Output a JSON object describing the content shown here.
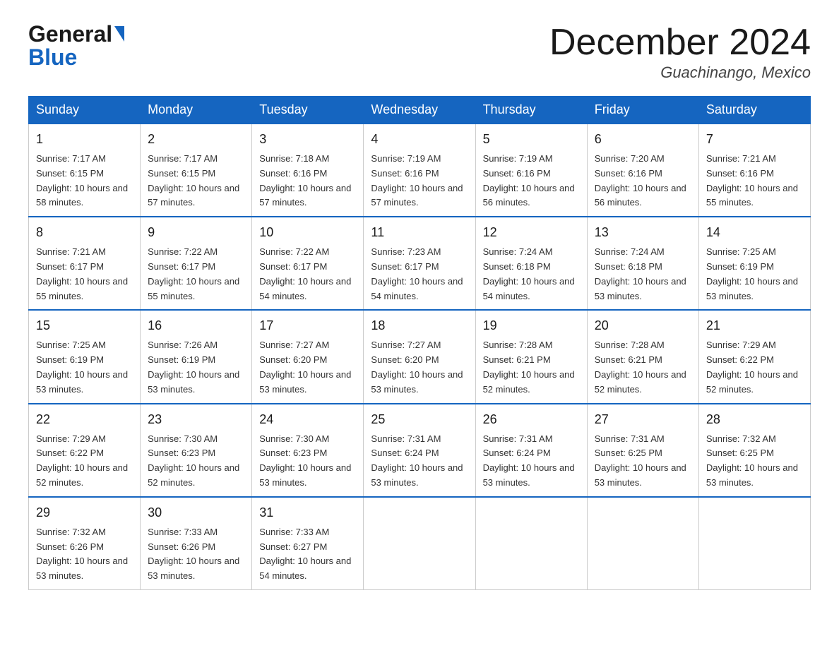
{
  "header": {
    "logo_general": "General",
    "logo_blue": "Blue",
    "month_title": "December 2024",
    "location": "Guachinango, Mexico"
  },
  "days_of_week": [
    "Sunday",
    "Monday",
    "Tuesday",
    "Wednesday",
    "Thursday",
    "Friday",
    "Saturday"
  ],
  "weeks": [
    [
      {
        "day": "1",
        "sunrise": "7:17 AM",
        "sunset": "6:15 PM",
        "daylight": "10 hours and 58 minutes."
      },
      {
        "day": "2",
        "sunrise": "7:17 AM",
        "sunset": "6:15 PM",
        "daylight": "10 hours and 57 minutes."
      },
      {
        "day": "3",
        "sunrise": "7:18 AM",
        "sunset": "6:16 PM",
        "daylight": "10 hours and 57 minutes."
      },
      {
        "day": "4",
        "sunrise": "7:19 AM",
        "sunset": "6:16 PM",
        "daylight": "10 hours and 57 minutes."
      },
      {
        "day": "5",
        "sunrise": "7:19 AM",
        "sunset": "6:16 PM",
        "daylight": "10 hours and 56 minutes."
      },
      {
        "day": "6",
        "sunrise": "7:20 AM",
        "sunset": "6:16 PM",
        "daylight": "10 hours and 56 minutes."
      },
      {
        "day": "7",
        "sunrise": "7:21 AM",
        "sunset": "6:16 PM",
        "daylight": "10 hours and 55 minutes."
      }
    ],
    [
      {
        "day": "8",
        "sunrise": "7:21 AM",
        "sunset": "6:17 PM",
        "daylight": "10 hours and 55 minutes."
      },
      {
        "day": "9",
        "sunrise": "7:22 AM",
        "sunset": "6:17 PM",
        "daylight": "10 hours and 55 minutes."
      },
      {
        "day": "10",
        "sunrise": "7:22 AM",
        "sunset": "6:17 PM",
        "daylight": "10 hours and 54 minutes."
      },
      {
        "day": "11",
        "sunrise": "7:23 AM",
        "sunset": "6:17 PM",
        "daylight": "10 hours and 54 minutes."
      },
      {
        "day": "12",
        "sunrise": "7:24 AM",
        "sunset": "6:18 PM",
        "daylight": "10 hours and 54 minutes."
      },
      {
        "day": "13",
        "sunrise": "7:24 AM",
        "sunset": "6:18 PM",
        "daylight": "10 hours and 53 minutes."
      },
      {
        "day": "14",
        "sunrise": "7:25 AM",
        "sunset": "6:19 PM",
        "daylight": "10 hours and 53 minutes."
      }
    ],
    [
      {
        "day": "15",
        "sunrise": "7:25 AM",
        "sunset": "6:19 PM",
        "daylight": "10 hours and 53 minutes."
      },
      {
        "day": "16",
        "sunrise": "7:26 AM",
        "sunset": "6:19 PM",
        "daylight": "10 hours and 53 minutes."
      },
      {
        "day": "17",
        "sunrise": "7:27 AM",
        "sunset": "6:20 PM",
        "daylight": "10 hours and 53 minutes."
      },
      {
        "day": "18",
        "sunrise": "7:27 AM",
        "sunset": "6:20 PM",
        "daylight": "10 hours and 53 minutes."
      },
      {
        "day": "19",
        "sunrise": "7:28 AM",
        "sunset": "6:21 PM",
        "daylight": "10 hours and 52 minutes."
      },
      {
        "day": "20",
        "sunrise": "7:28 AM",
        "sunset": "6:21 PM",
        "daylight": "10 hours and 52 minutes."
      },
      {
        "day": "21",
        "sunrise": "7:29 AM",
        "sunset": "6:22 PM",
        "daylight": "10 hours and 52 minutes."
      }
    ],
    [
      {
        "day": "22",
        "sunrise": "7:29 AM",
        "sunset": "6:22 PM",
        "daylight": "10 hours and 52 minutes."
      },
      {
        "day": "23",
        "sunrise": "7:30 AM",
        "sunset": "6:23 PM",
        "daylight": "10 hours and 52 minutes."
      },
      {
        "day": "24",
        "sunrise": "7:30 AM",
        "sunset": "6:23 PM",
        "daylight": "10 hours and 53 minutes."
      },
      {
        "day": "25",
        "sunrise": "7:31 AM",
        "sunset": "6:24 PM",
        "daylight": "10 hours and 53 minutes."
      },
      {
        "day": "26",
        "sunrise": "7:31 AM",
        "sunset": "6:24 PM",
        "daylight": "10 hours and 53 minutes."
      },
      {
        "day": "27",
        "sunrise": "7:31 AM",
        "sunset": "6:25 PM",
        "daylight": "10 hours and 53 minutes."
      },
      {
        "day": "28",
        "sunrise": "7:32 AM",
        "sunset": "6:25 PM",
        "daylight": "10 hours and 53 minutes."
      }
    ],
    [
      {
        "day": "29",
        "sunrise": "7:32 AM",
        "sunset": "6:26 PM",
        "daylight": "10 hours and 53 minutes."
      },
      {
        "day": "30",
        "sunrise": "7:33 AM",
        "sunset": "6:26 PM",
        "daylight": "10 hours and 53 minutes."
      },
      {
        "day": "31",
        "sunrise": "7:33 AM",
        "sunset": "6:27 PM",
        "daylight": "10 hours and 54 minutes."
      },
      null,
      null,
      null,
      null
    ]
  ]
}
